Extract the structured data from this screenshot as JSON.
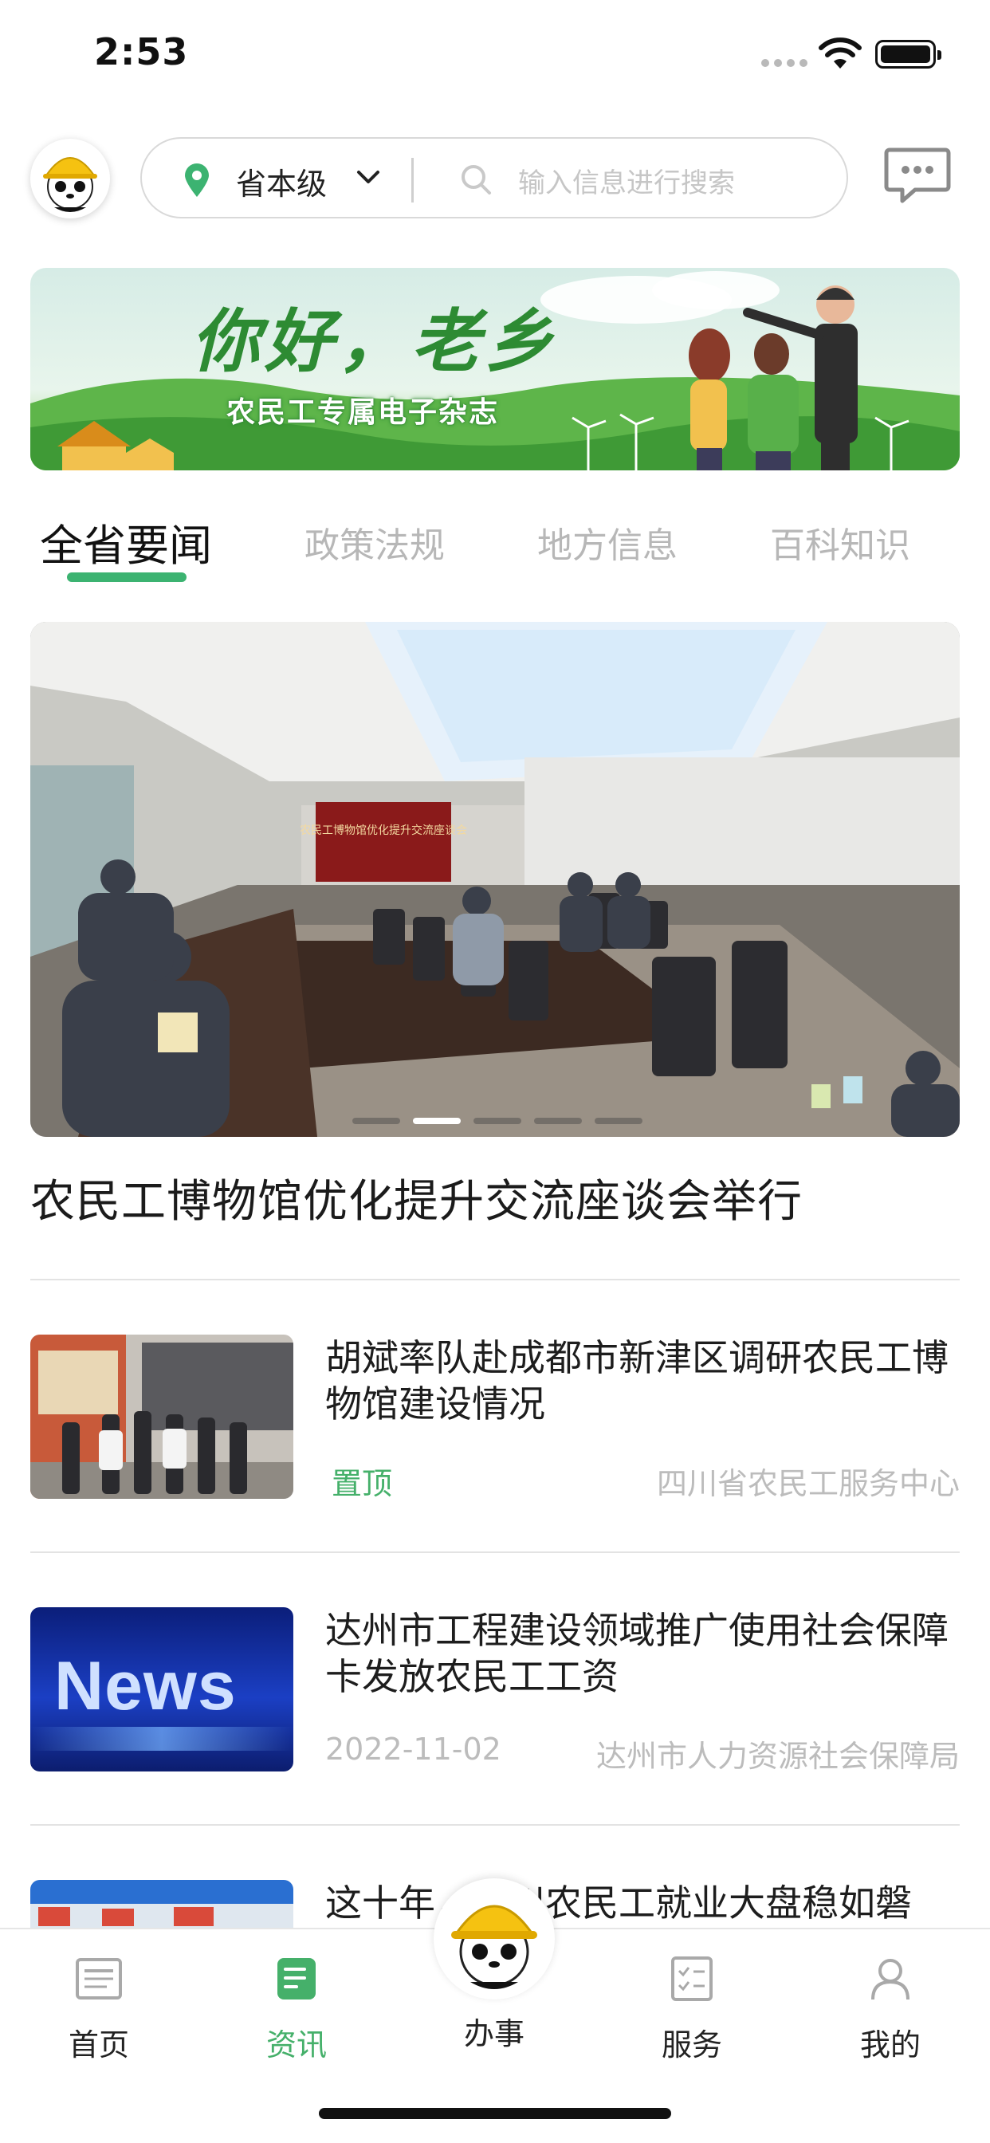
{
  "status_bar": {
    "time": "2:53"
  },
  "header": {
    "region": "省本级",
    "search_placeholder": "输入信息进行搜索"
  },
  "banner": {
    "title": "你好，老乡",
    "subtitle": "农民工专属电子杂志"
  },
  "tabs": [
    {
      "label": "全省要闻",
      "active": true
    },
    {
      "label": "政策法规",
      "active": false
    },
    {
      "label": "地方信息",
      "active": false
    },
    {
      "label": "百科知识",
      "active": false
    }
  ],
  "carousel": {
    "title": "农民工博物馆优化提升交流座谈会举行",
    "slide_count": 5,
    "active_index": 1,
    "screen_text": "农民工博物馆优化提升交流座谈会"
  },
  "news": [
    {
      "title": "胡斌率队赴成都市新津区调研农民工博物馆建设情况",
      "tag": "置顶",
      "date": "",
      "source": "四川省农民工服务中心",
      "thumb_icon": "museum-visit-photo"
    },
    {
      "title": "达州市工程建设领域推广使用社会保障卡发放农民工工资",
      "tag": "",
      "date": "2022-11-02",
      "source": "达州市人力资源社会保障局",
      "thumb_icon": "news-graphic",
      "thumb_text": "News"
    },
    {
      "title": "这十年，四川农民工就业大盘稳如磐",
      "tag": "",
      "date": "",
      "source": "",
      "thumb_icon": "job-fair-photo"
    }
  ],
  "bottom_nav": [
    {
      "label": "首页",
      "icon": "newspaper-icon",
      "active": false
    },
    {
      "label": "资讯",
      "icon": "info-doc-icon",
      "active": true
    },
    {
      "label": "办事",
      "icon": "panda-mascot-icon",
      "active": false
    },
    {
      "label": "服务",
      "icon": "checklist-icon",
      "active": false
    },
    {
      "label": "我的",
      "icon": "user-icon",
      "active": false
    }
  ],
  "colors": {
    "accent": "#45b06a",
    "underline": "#3cb371",
    "muted": "#bcbcbc"
  }
}
